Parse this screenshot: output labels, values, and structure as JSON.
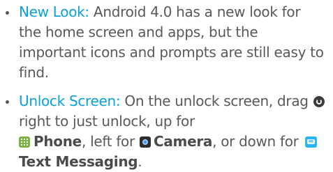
{
  "items": [
    {
      "term": "New Look:",
      "text": " Android 4.0 has a new look for the home screen and apps, but the important icons and prompts are still easy to find."
    },
    {
      "term": "Unlock Screen:",
      "text_1": " On the unlock screen, drag ",
      "lock_icon": "lock-ring-icon",
      "text_2": " right to just unlock, up for ",
      "phone_icon": "phone-dialpad-icon",
      "phone_label": "Phone",
      "text_3": ", left for ",
      "camera_icon": "camera-icon",
      "camera_label": "Camera",
      "text_4": ", or down for ",
      "sms_icon": "text-message-icon",
      "sms_label": "Text Messaging",
      "text_5": "."
    }
  ],
  "colors": {
    "term": "#0aa1dd",
    "body_text": "#58595b",
    "phone_icon": "#7cb342",
    "sms_icon": "#29b6f6"
  }
}
